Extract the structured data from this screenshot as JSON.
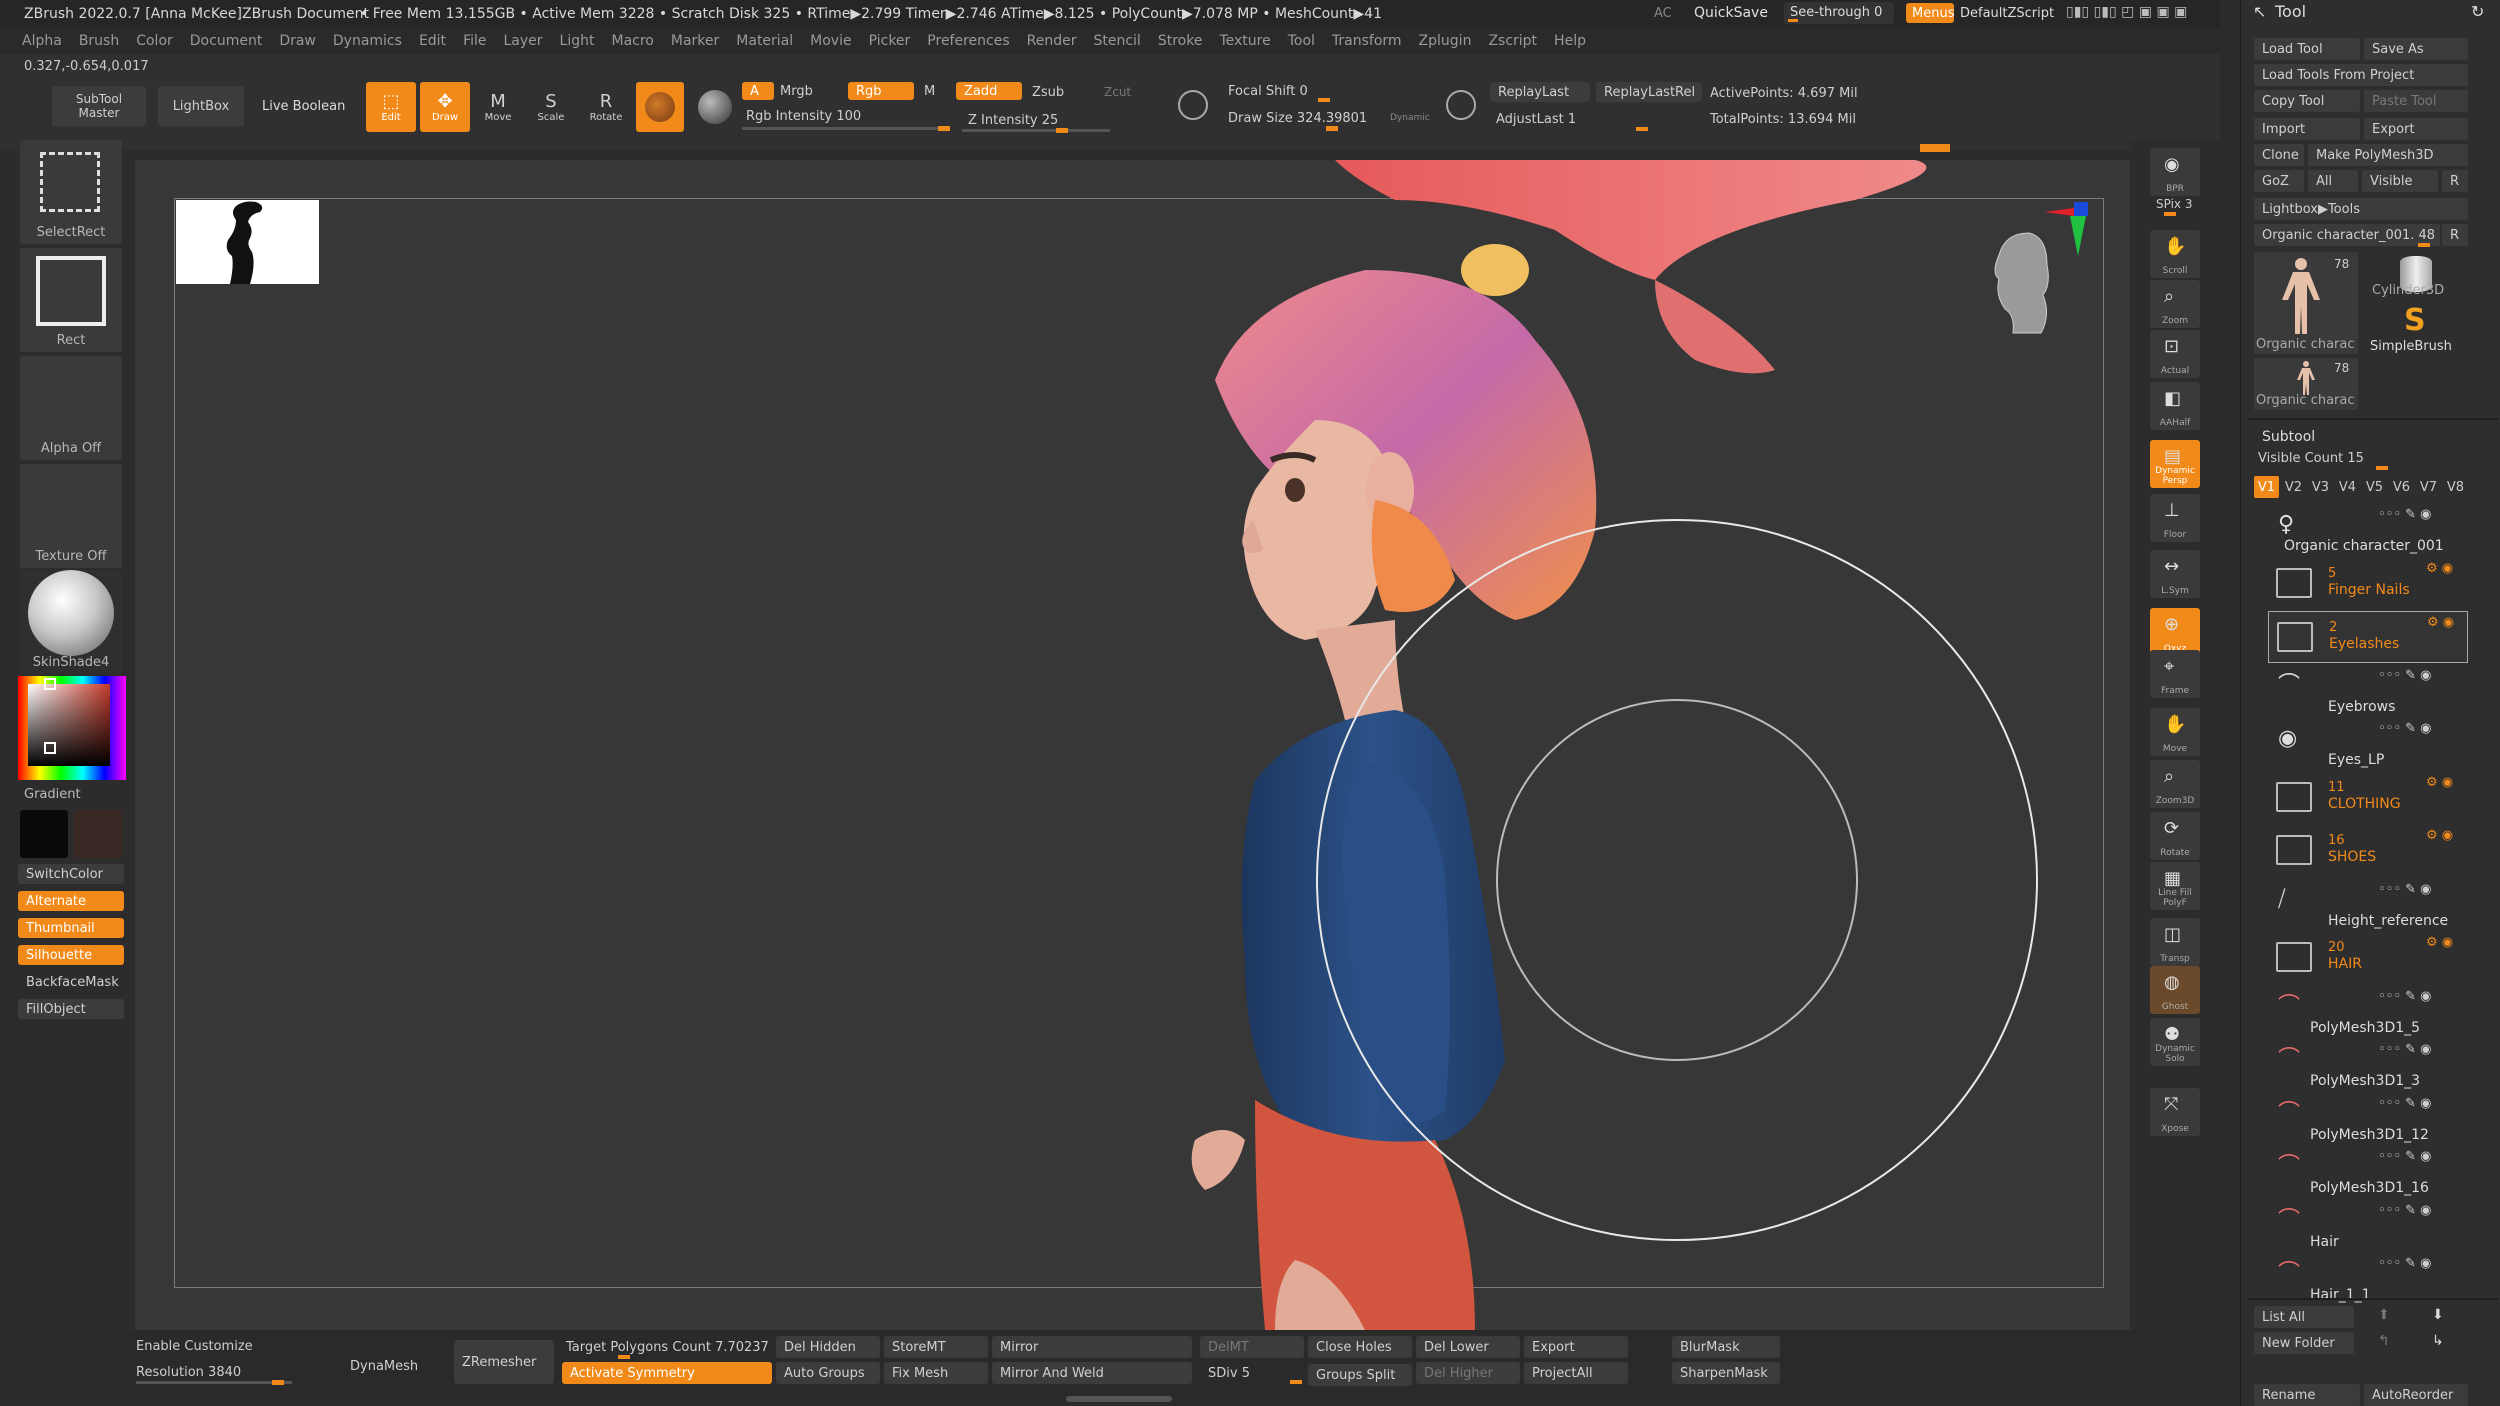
{
  "title_bar": {
    "app": "ZBrush 2022.0.7 [Anna McKee]ZBrush Document",
    "stats": "• Free Mem 13.155GB • Active Mem 3228 • Scratch Disk 325 • RTime▶2.799 Timer▶2.746 ATime▶8.125 • PolyCount▶7.078 MP • MeshCount▶41",
    "ac": "AC",
    "quicksave": "QuickSave",
    "see_through": "See-through 0",
    "menus": "Menus",
    "default_zscript": "DefaultZScript"
  },
  "menu": [
    "Alpha",
    "Brush",
    "Color",
    "Document",
    "Draw",
    "Dynamics",
    "Edit",
    "File",
    "Layer",
    "Light",
    "Macro",
    "Marker",
    "Material",
    "Movie",
    "Picker",
    "Preferences",
    "Render",
    "Stencil",
    "Stroke",
    "Texture",
    "Tool",
    "Transform",
    "Zplugin",
    "Zscript",
    "Help"
  ],
  "coords": "0.327,-0.654,0.017",
  "toolbar": {
    "subtool_master": "SubTool Master",
    "lightbox": "LightBox",
    "live_boolean": "Live Boolean",
    "edit": "Edit",
    "draw": "Draw",
    "move": "Move",
    "scale": "Scale",
    "rotate": "Rotate",
    "a": "A",
    "mrgb": "Mrgb",
    "rgb": "Rgb",
    "m": "M",
    "zadd": "Zadd",
    "zsub": "Zsub",
    "zcut": "Zcut",
    "rgb_intensity": "Rgb Intensity 100",
    "z_intensity": "Z Intensity 25",
    "focal_shift": "Focal Shift 0",
    "draw_size": "Draw Size 324.39801",
    "dynamic": "Dynamic",
    "replay_last": "ReplayLast",
    "replay_last_rel": "ReplayLastRel",
    "adjust_last": "AdjustLast 1",
    "active_points": "ActivePoints: 4.697 Mil",
    "total_points": "TotalPoints: 13.694 Mil"
  },
  "left_shelf": {
    "select_rect": "SelectRect",
    "rect": "Rect",
    "alpha_off": "Alpha Off",
    "texture_off": "Texture Off",
    "material": "SkinShade4",
    "gradient": "Gradient",
    "switch_color": "SwitchColor",
    "alternate": "Alternate",
    "thumbnail": "Thumbnail",
    "silhouette": "Silhouette",
    "backface_mask": "BackfaceMask",
    "fill_object": "FillObject"
  },
  "right_shelf": [
    "BPR",
    "SPix 3",
    "Scroll",
    "Zoom",
    "Actual",
    "AAHalf",
    "Dynamic Persp",
    "Floor",
    "L.Sym",
    "Qxyz",
    "Frame",
    "Move",
    "Zoom3D",
    "Rotate",
    "Line Fill PolyF",
    "Transp",
    "Ghost",
    "Dynamic Solo",
    "Xpose"
  ],
  "bottom": {
    "enable_customize": "Enable Customize",
    "resolution": "Resolution 3840",
    "dynamesh": "DynaMesh",
    "zremesher": "ZRemesher",
    "target_polygons": "Target Polygons Count 7.70237",
    "activate_symmetry": "Activate Symmetry",
    "del_hidden": "Del Hidden",
    "auto_groups": "Auto Groups",
    "store_mt": "StoreMT",
    "fix_mesh": "Fix Mesh",
    "mirror": "Mirror",
    "mirror_and_weld": "Mirror And Weld",
    "del_mt": "DelMT",
    "sdiv": "SDiv 5",
    "close_holes": "Close Holes",
    "groups_split": "Groups Split",
    "del_lower": "Del Lower",
    "del_higher": "Del Higher",
    "export": "Export",
    "project_all": "ProjectAll",
    "blur_mask": "BlurMask",
    "sharpen_mask": "SharpenMask"
  },
  "tool_panel": {
    "title": "Tool",
    "load_tool": "Load Tool",
    "save_as": "Save As",
    "load_from_project": "Load Tools From Project",
    "copy_tool": "Copy Tool",
    "paste_tool": "Paste Tool",
    "import": "Import",
    "export": "Export",
    "clone": "Clone",
    "make_polymesh": "Make PolyMesh3D",
    "goz": "GoZ",
    "all": "All",
    "visible": "Visible",
    "r": "R",
    "lightbox_tools": "Lightbox▶Tools",
    "current_tool": "Organic character_001. 48",
    "r2": "R",
    "thumb_count1": "78",
    "thumb1": "Organic charac",
    "cylinder": "Cylinder3D",
    "simplebrush": "SimpleBrush",
    "thumb_count2": "78",
    "thumb2": "Organic charac"
  },
  "subtool": {
    "title": "Subtool",
    "visible_count": "Visible Count 15",
    "versions": [
      "V1",
      "V2",
      "V3",
      "V4",
      "V5",
      "V6",
      "V7",
      "V8"
    ],
    "items": [
      {
        "name": "Organic character_001",
        "count": ""
      },
      {
        "name": "Finger Nails",
        "count": "5"
      },
      {
        "name": "Eyelashes",
        "count": "2"
      },
      {
        "name": "Eyebrows",
        "count": ""
      },
      {
        "name": "Eyes_LP",
        "count": ""
      },
      {
        "name": "CLOTHING",
        "count": "11"
      },
      {
        "name": "SHOES",
        "count": "16"
      },
      {
        "name": "Height_reference",
        "count": ""
      },
      {
        "name": "HAIR",
        "count": "20"
      },
      {
        "name": "PolyMesh3D1_5",
        "count": ""
      },
      {
        "name": "PolyMesh3D1_3",
        "count": ""
      },
      {
        "name": "PolyMesh3D1_12",
        "count": ""
      },
      {
        "name": "PolyMesh3D1_16",
        "count": ""
      },
      {
        "name": "Hair",
        "count": ""
      },
      {
        "name": "Hair_1_1",
        "count": ""
      }
    ],
    "list_all": "List All",
    "new_folder": "New Folder",
    "rename": "Rename",
    "auto_reorder": "AutoReorder"
  },
  "colors": {
    "accent": "#f28a1a",
    "hair": "#e86a6a",
    "sweater": "#274a7a",
    "skin": "#e6b3a0",
    "pants": "#d2553f"
  }
}
